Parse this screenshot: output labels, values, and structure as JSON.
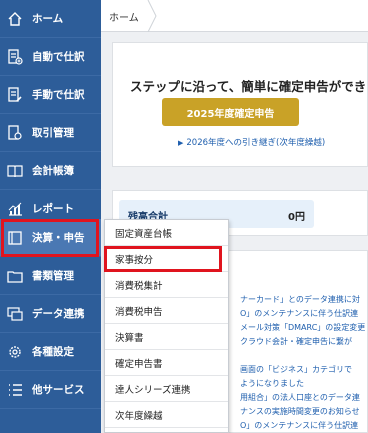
{
  "sidebar": {
    "items": [
      {
        "label": "ホーム",
        "icon": "home-icon"
      },
      {
        "label": "自動で仕訳",
        "icon": "auto-entry-icon"
      },
      {
        "label": "手動で仕訳",
        "icon": "manual-entry-icon"
      },
      {
        "label": "取引管理",
        "icon": "transaction-icon"
      },
      {
        "label": "会計帳簿",
        "icon": "ledger-book-icon"
      },
      {
        "label": "レポート",
        "icon": "report-chart-icon"
      },
      {
        "label": "決算・申告",
        "icon": "tax-return-icon"
      },
      {
        "label": "書類管理",
        "icon": "folder-icon"
      },
      {
        "label": "データ連携",
        "icon": "data-link-icon"
      },
      {
        "label": "各種設定",
        "icon": "gear-icon"
      },
      {
        "label": "他サービス",
        "icon": "list-icon"
      }
    ],
    "active_index": 6
  },
  "breadcrumb": {
    "home": "ホーム"
  },
  "hero": {
    "title": "ステップに沿って、簡単に確定申告ができ",
    "button_label": "2025年度確定申告",
    "link_label": "2026年度への引き継ぎ(次年度繰越)"
  },
  "balance": {
    "label": "残高合計",
    "value": "0円"
  },
  "news": [
    "ナーカード」とのデータ連携に対",
    "O」のメンテナンスに伴う仕訳連",
    "メール対策「DMARC」の設定変更",
    "クラウド会計・確定申告に繋が",
    "画面の「ビジネス」カテゴリで",
    "ようになりました",
    "用組合」の法人口座とのデータ連",
    "ナンスの実施時間変更のお知らせ",
    "O」のメンテナンスに伴う仕訳連"
  ],
  "dropdown": {
    "items": [
      "固定資産台帳",
      "家事按分",
      "消費税集計",
      "消費税申告",
      "決算書",
      "確定申告書",
      "達人シリーズ連携",
      "次年度繰越"
    ],
    "highlighted_index": 1
  },
  "colors": {
    "sidebar_bg": "#2d5d99",
    "highlight_red": "#e0141e",
    "gold_button": "#c9a227",
    "link_blue": "#1f5fae"
  }
}
